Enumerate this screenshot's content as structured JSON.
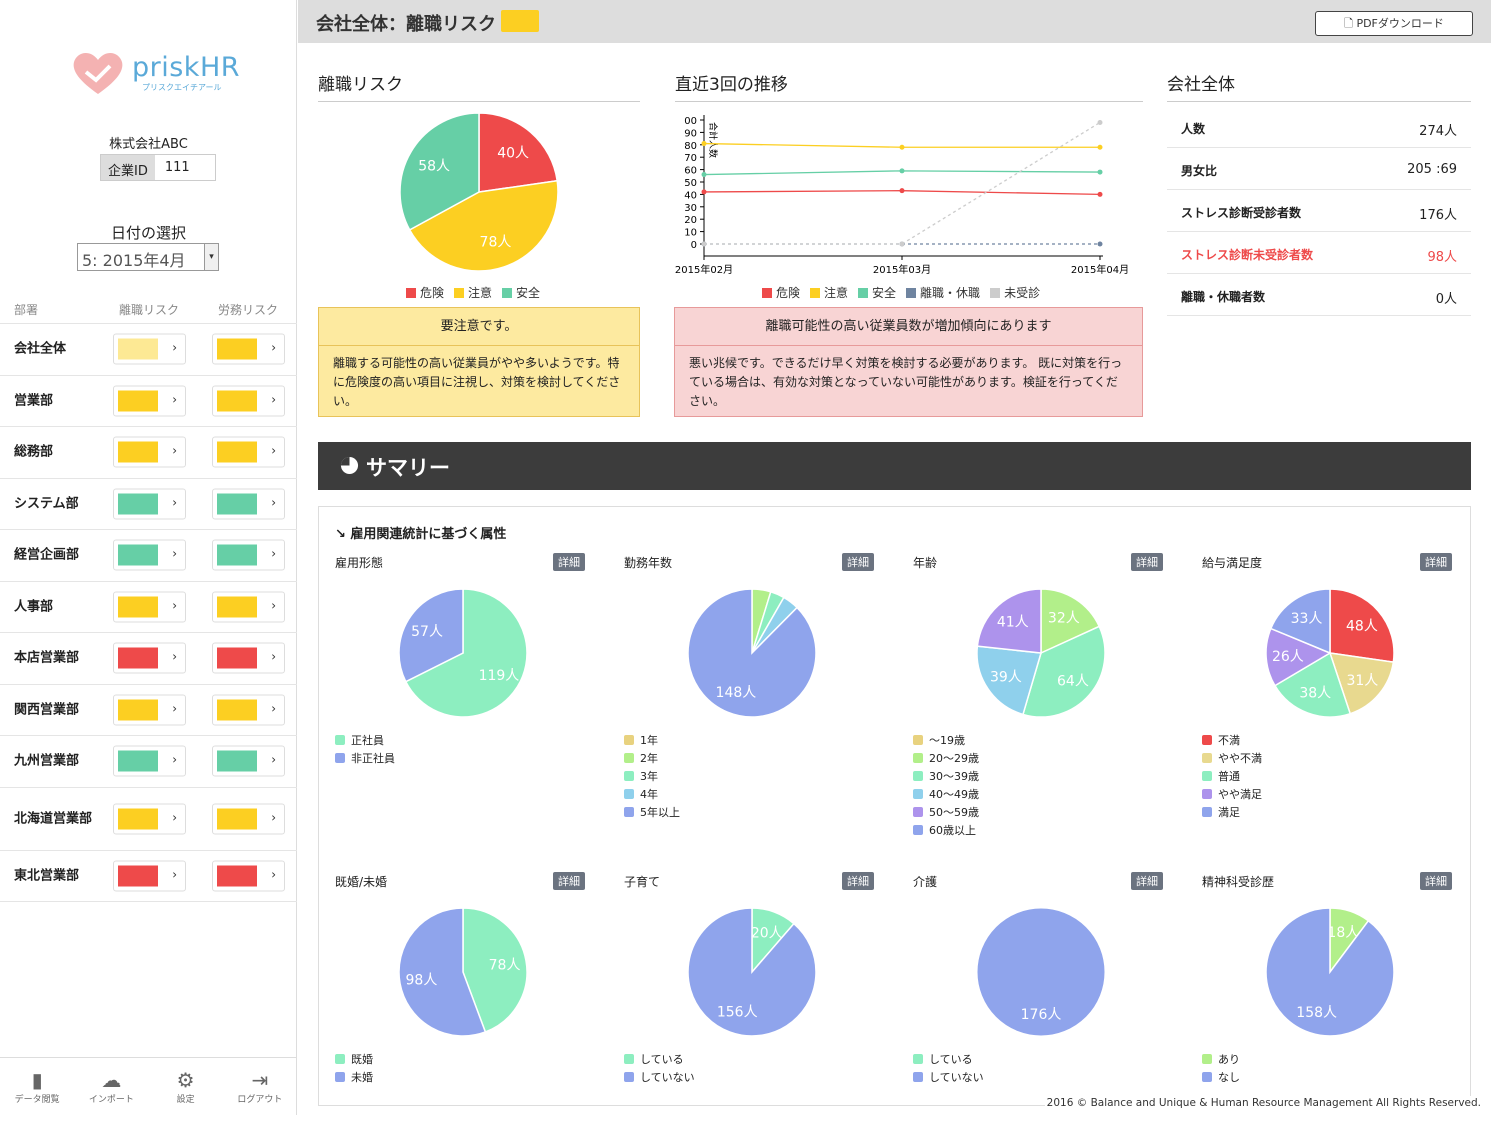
{
  "brand": {
    "name": "priskHR",
    "subtitle": "プリスクエイチアール"
  },
  "company": {
    "name": "株式会社ABC",
    "id_label": "企業ID",
    "id_value": "111"
  },
  "date": {
    "label": "日付の選択",
    "selected": "5: 2015年4月"
  },
  "dept_header": {
    "dept": "部署",
    "turnover": "離職リスク",
    "labor": "労務リスク"
  },
  "colors": {
    "danger": "#ee4a4a",
    "caution": "#fccf22",
    "safe": "#66cfa6",
    "leave": "#6f84a0",
    "unexam": "#cccccc",
    "caution_light": "#fde994"
  },
  "departments": [
    {
      "name": "会社全体",
      "turnover": "caution_light",
      "labor": "caution"
    },
    {
      "name": "営業部",
      "turnover": "caution",
      "labor": "caution"
    },
    {
      "name": "総務部",
      "turnover": "caution",
      "labor": "caution"
    },
    {
      "name": "システム部",
      "turnover": "safe",
      "labor": "safe"
    },
    {
      "name": "経営企画部",
      "turnover": "safe",
      "labor": "safe"
    },
    {
      "name": "人事部",
      "turnover": "caution",
      "labor": "caution"
    },
    {
      "name": "本店営業部",
      "turnover": "danger",
      "labor": "danger"
    },
    {
      "name": "関西営業部",
      "turnover": "caution",
      "labor": "caution"
    },
    {
      "name": "九州営業部",
      "turnover": "safe",
      "labor": "safe"
    },
    {
      "name": "北海道営業部",
      "turnover": "caution",
      "labor": "caution"
    },
    {
      "name": "東北営業部",
      "turnover": "danger",
      "labor": "danger"
    }
  ],
  "nav": [
    {
      "label": "データ閲覧",
      "icon": "bar-chart-icon"
    },
    {
      "label": "インポート",
      "icon": "cloud-upload-icon"
    },
    {
      "label": "設定",
      "icon": "gear-icon"
    },
    {
      "label": "ログアウト",
      "icon": "logout-icon"
    }
  ],
  "header": {
    "title": "会社全体：離職リスク",
    "pdf": "PDFダウンロード"
  },
  "risk_section": {
    "title": "離職リスク",
    "legend": [
      "危険",
      "注意",
      "安全"
    ]
  },
  "trend_section": {
    "title": "直近3回の推移",
    "legend": [
      "危険",
      "注意",
      "安全",
      "離職・休職",
      "未受診"
    ]
  },
  "company_section": {
    "title": "会社全体"
  },
  "alert1": {
    "head": "要注意です。",
    "body": "離職する可能性の高い従業員がやや多いようです。特に危険度の高い項目に注視し、対策を検討してください。"
  },
  "alert2": {
    "head": "離職可能性の高い従業員数が増加傾向にあります",
    "body": "悪い兆候です。できるだけ早く対策を検討する必要があります。 既に対策を行っている場合は、有効な対策となっていない可能性があります。検証を行ってください。"
  },
  "stats": [
    {
      "k": "人数",
      "v": "274人"
    },
    {
      "k": "男女比",
      "v": "205 :69"
    },
    {
      "k": "ストレス診断受診者数",
      "v": "176人"
    },
    {
      "k": "ストレス診断未受診者数",
      "v": "98人",
      "warn": true
    },
    {
      "k": "離職・休職者数",
      "v": "0人"
    }
  ],
  "summary": {
    "title": "サマリー",
    "attr_title": "雇用関連統計に基づく属性",
    "detail": "詳細"
  },
  "footer": "2016 © Balance and Unique & Human Resource Management All Rights Reserved.",
  "chart_data": [
    {
      "type": "pie",
      "title": "離職リスク",
      "labels": [
        "危険",
        "注意",
        "安全"
      ],
      "values": [
        40,
        78,
        58
      ],
      "colors": [
        "#ee4a4a",
        "#fccf22",
        "#66cfa6"
      ]
    },
    {
      "type": "line",
      "title": "直近3回の推移",
      "x": [
        "2015年02月",
        "2015年03月",
        "2015年04月"
      ],
      "ylabel": "合計人数",
      "ylim": [
        0,
        100
      ],
      "yticks": [
        0,
        10,
        20,
        30,
        40,
        50,
        60,
        70,
        80,
        90,
        "00"
      ],
      "series": [
        {
          "name": "危険",
          "values": [
            42,
            43,
            40
          ],
          "color": "#ee4a4a"
        },
        {
          "name": "注意",
          "values": [
            81,
            78,
            78
          ],
          "color": "#fccf22"
        },
        {
          "name": "安全",
          "values": [
            56,
            59,
            58
          ],
          "color": "#66cfa6"
        },
        {
          "name": "離職・休職",
          "values": [
            0,
            0,
            0
          ],
          "color": "#6f84a0"
        },
        {
          "name": "未受診",
          "values": [
            0,
            0,
            98
          ],
          "color": "#cccccc"
        }
      ]
    },
    {
      "type": "pie",
      "title": "雇用形態",
      "labels": [
        "正社員",
        "非正社員"
      ],
      "values": [
        119,
        57
      ],
      "colors": [
        "#8deec0",
        "#8fa4ec"
      ]
    },
    {
      "type": "pie",
      "title": "勤務年数",
      "labels": [
        "1年",
        "2年",
        "3年",
        "4年",
        "5年以上"
      ],
      "values": [
        0,
        8,
        6,
        7,
        148
      ],
      "colors": [
        "#e8d27f",
        "#b2ef8a",
        "#8deec0",
        "#8fd0ec",
        "#8fa4ec"
      ],
      "shown": [
        false,
        false,
        false,
        false,
        true
      ]
    },
    {
      "type": "pie",
      "title": "年齢",
      "labels": [
        "～19歳",
        "20～29歳",
        "30～39歳",
        "40～49歳",
        "50～59歳",
        "60歳以上"
      ],
      "values": [
        0,
        32,
        64,
        39,
        41,
        0
      ],
      "colors": [
        "#e8d27f",
        "#b2ef8a",
        "#8deec0",
        "#8fd0ec",
        "#ad93ec",
        "#8fa4ec"
      ]
    },
    {
      "type": "pie",
      "title": "給与満足度",
      "labels": [
        "不満",
        "やや不満",
        "普通",
        "やや満足",
        "満足"
      ],
      "values": [
        48,
        31,
        38,
        26,
        33
      ],
      "colors": [
        "#ee4a4a",
        "#e8d98f",
        "#8deec0",
        "#ad93ec",
        "#8fa4ec"
      ]
    },
    {
      "type": "pie",
      "title": "既婚/未婚",
      "labels": [
        "既婚",
        "未婚"
      ],
      "values": [
        78,
        98
      ],
      "colors": [
        "#8deec0",
        "#8fa4ec"
      ]
    },
    {
      "type": "pie",
      "title": "子育て",
      "labels": [
        "している",
        "していない"
      ],
      "values": [
        20,
        156
      ],
      "colors": [
        "#8deec0",
        "#8fa4ec"
      ]
    },
    {
      "type": "pie",
      "title": "介護",
      "labels": [
        "している",
        "していない"
      ],
      "values": [
        0,
        176
      ],
      "colors": [
        "#8deec0",
        "#8fa4ec"
      ]
    },
    {
      "type": "pie",
      "title": "精神科受診歴",
      "labels": [
        "あり",
        "なし"
      ],
      "values": [
        18,
        158
      ],
      "colors": [
        "#b2ef8a",
        "#8fa4ec"
      ]
    }
  ]
}
